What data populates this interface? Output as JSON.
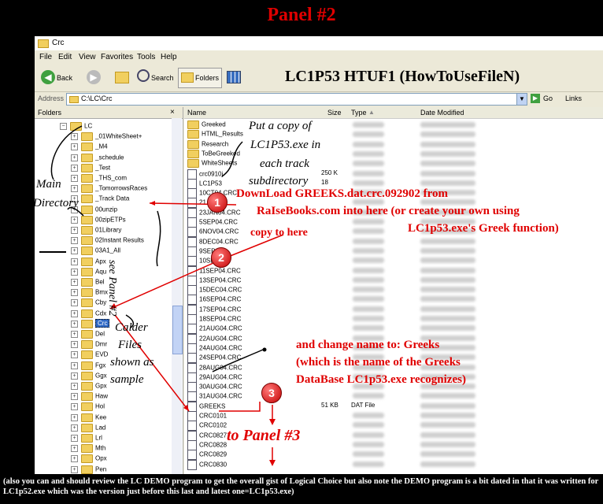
{
  "panel_title": "Panel #2",
  "window": {
    "title": "Crc",
    "menu": [
      "File",
      "Edit",
      "View",
      "Favorites",
      "Tools",
      "Help"
    ],
    "toolbar": {
      "back": "Back",
      "search": "Search",
      "folders": "Folders"
    },
    "overlay_title": "LC1P53 HTUF1 (HowToUseFileN)",
    "address_label": "Address",
    "address_value": "C:\\LC\\Crc",
    "go_label": "Go",
    "links_label": "Links",
    "folders_header": "Folders",
    "columns": {
      "name": "Name",
      "size": "Size",
      "type": "Type",
      "date": "Date Modified"
    }
  },
  "tree": [
    {
      "label": "LC"
    },
    {
      "label": "_01WhiteSheet+"
    },
    {
      "label": "_M4"
    },
    {
      "label": "_schedule"
    },
    {
      "label": "_Test"
    },
    {
      "label": "_THS_com"
    },
    {
      "label": "_TomorrowsRaces"
    },
    {
      "label": "_Track Data"
    },
    {
      "label": "00unzip"
    },
    {
      "label": "00zipETPs"
    },
    {
      "label": "01Library"
    },
    {
      "label": "02Instant Results"
    },
    {
      "label": "03A1_All"
    },
    {
      "label": "Apx"
    },
    {
      "label": "Aqu"
    },
    {
      "label": "Bel"
    },
    {
      "label": "Bmx"
    },
    {
      "label": "Cby"
    },
    {
      "label": "Cdx"
    },
    {
      "label": "Crc"
    },
    {
      "label": "Del"
    },
    {
      "label": "Dmr"
    },
    {
      "label": "EVD"
    },
    {
      "label": "Fgx"
    },
    {
      "label": "Ggx"
    },
    {
      "label": "Gpx"
    },
    {
      "label": "Haw"
    },
    {
      "label": "Hol"
    },
    {
      "label": "Kee"
    },
    {
      "label": "Lad"
    },
    {
      "label": "Lrl"
    },
    {
      "label": "Mth"
    },
    {
      "label": "Opx"
    },
    {
      "label": "Pen"
    }
  ],
  "files": [
    {
      "name": "Greeked",
      "size": "",
      "type": ""
    },
    {
      "name": "HTML_Results",
      "size": "",
      "type": ""
    },
    {
      "name": "Research",
      "size": "",
      "type": ""
    },
    {
      "name": "ToBeGreeked",
      "size": "",
      "type": ""
    },
    {
      "name": "WhiteSheets",
      "size": "",
      "type": ""
    },
    {
      "name": "crc0910j",
      "size": "250 K",
      "type": ""
    },
    {
      "name": "LC1P53",
      "size": "18",
      "type": ""
    },
    {
      "name": "10CT04.CRC",
      "size": "",
      "type": ""
    },
    {
      "name": "21...",
      "size": "",
      "type": ""
    },
    {
      "name": "23JAN04.CRC",
      "size": "",
      "type": ""
    },
    {
      "name": "5SEP04.CRC",
      "size": "",
      "type": ""
    },
    {
      "name": "6NOV04.CRC",
      "size": "",
      "type": ""
    },
    {
      "name": "8DEC04.CRC",
      "size": "",
      "type": ""
    },
    {
      "name": "9SEP04...",
      "size": "",
      "type": ""
    },
    {
      "name": "10SEP...",
      "size": "",
      "type": ""
    },
    {
      "name": "11SEP04.CRC",
      "size": "",
      "type": ""
    },
    {
      "name": "13SEP04.CRC",
      "size": "",
      "type": ""
    },
    {
      "name": "15DEC04.CRC",
      "size": "",
      "type": ""
    },
    {
      "name": "16SEP04.CRC",
      "size": "",
      "type": ""
    },
    {
      "name": "17SEP04.CRC",
      "size": "",
      "type": ""
    },
    {
      "name": "18SEP04.CRC",
      "size": "",
      "type": ""
    },
    {
      "name": "21AUG04.CRC",
      "size": "",
      "type": ""
    },
    {
      "name": "22AUG04.CRC",
      "size": "",
      "type": ""
    },
    {
      "name": "24AUG04.CRC",
      "size": "",
      "type": ""
    },
    {
      "name": "24SEP04.CRC",
      "size": "",
      "type": ""
    },
    {
      "name": "28AUG04.CRC",
      "size": "",
      "type": ""
    },
    {
      "name": "29AUG04.CRC",
      "size": "",
      "type": ""
    },
    {
      "name": "30AUG04.CRC",
      "size": "",
      "type": ""
    },
    {
      "name": "31AUG04.CRC",
      "size": "",
      "type": ""
    },
    {
      "name": "GREEKS",
      "size": "51 KB",
      "type": "DAT File"
    },
    {
      "name": "CRC0101",
      "size": "",
      "type": ""
    },
    {
      "name": "CRC0102",
      "size": "",
      "type": ""
    },
    {
      "name": "CRC0827",
      "size": "",
      "type": ""
    },
    {
      "name": "CRC0828",
      "size": "",
      "type": ""
    },
    {
      "name": "CRC0829",
      "size": "",
      "type": ""
    },
    {
      "name": "CRC0830",
      "size": "",
      "type": ""
    }
  ],
  "annotations": {
    "put_copy": [
      "Put a copy of",
      "LC1P53.exe in",
      "each track",
      "subdirectory"
    ],
    "download": [
      "DownLoad GREEKS.dat.crc.092902 from",
      "RaIseBooks.com into here (or create your own using",
      "LC1p53.exe's Greek function)"
    ],
    "copy_here": "copy to here",
    "main_dir": [
      "Main",
      "Directory"
    ],
    "see_panel": "see Panel #2",
    "calder": [
      "Calder",
      "Files",
      "shown as",
      "sample"
    ],
    "change_name": [
      "and change name to: Greeks",
      "(which is the name of the Greeks",
      "DataBase LC1p53.exe recognizes)"
    ],
    "to_panel3": "to Panel #3",
    "badge1": "1",
    "badge2": "2",
    "badge3": "3"
  },
  "footer": "(also you can and should review the LC DEMO program to get the overall gist of Logical Choice but also note the DEMO program is a bit dated in that it was written for LC1p52.exe which was the version just before this last and latest one=LC1p53.exe)"
}
